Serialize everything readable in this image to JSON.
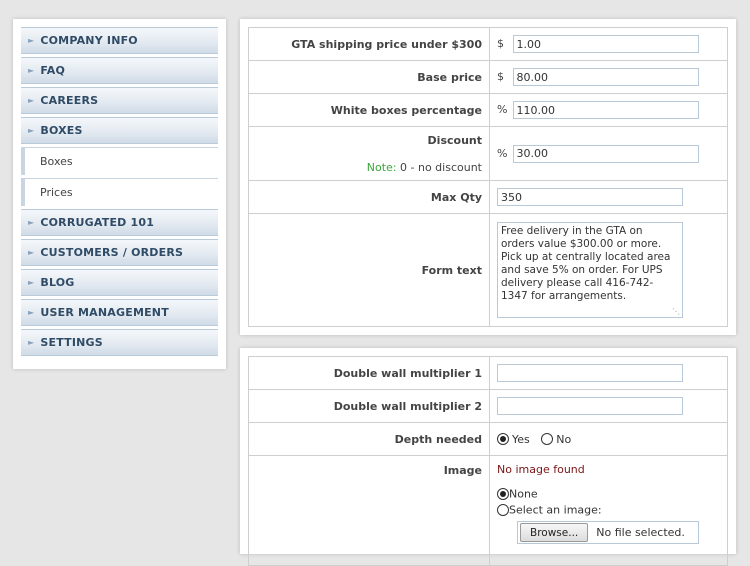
{
  "sidebar": {
    "items": [
      {
        "label": "COMPANY INFO"
      },
      {
        "label": "FAQ"
      },
      {
        "label": "CAREERS"
      },
      {
        "label": "BOXES"
      },
      {
        "label": "Boxes"
      },
      {
        "label": "Prices"
      },
      {
        "label": "CORRUGATED 101"
      },
      {
        "label": "CUSTOMERS / ORDERS"
      },
      {
        "label": "BLOG"
      },
      {
        "label": "USER MANAGEMENT"
      },
      {
        "label": "SETTINGS"
      }
    ]
  },
  "prices_form": {
    "gta_shipping": {
      "label": "GTA shipping price under $300",
      "currency": "$",
      "value": "1.00"
    },
    "base_price": {
      "label": "Base price",
      "currency": "$",
      "value": "80.00"
    },
    "white_boxes": {
      "label": "White boxes percentage",
      "unit": "%",
      "value": "110.00"
    },
    "discount": {
      "label": "Discount",
      "note_key": "Note:",
      "note_text": " 0 - no discount",
      "unit": "%",
      "value": "30.00"
    },
    "max_qty": {
      "label": "Max Qty",
      "value": "350"
    },
    "form_text": {
      "label": "Form text",
      "value": "Free delivery in the GTA on orders value $300.00 or more. Pick up at centrally located area and save 5% on order. For UPS delivery please call 416-742-1347 for arrangements."
    }
  },
  "box_form": {
    "dw_mult_1": {
      "label": "Double wall multiplier 1",
      "value": ""
    },
    "dw_mult_2": {
      "label": "Double wall multiplier 2",
      "value": ""
    },
    "depth": {
      "label": "Depth needed",
      "yes": "Yes",
      "no": "No",
      "selected": "Yes"
    },
    "image": {
      "label": "Image",
      "status": "No image found",
      "opt_none": "None",
      "opt_select": "Select an image:",
      "selected": "None",
      "browse_label": "Browse...",
      "file_status": "No file selected."
    }
  },
  "icons": {
    "nav_arrow": "arrow-right-icon"
  }
}
